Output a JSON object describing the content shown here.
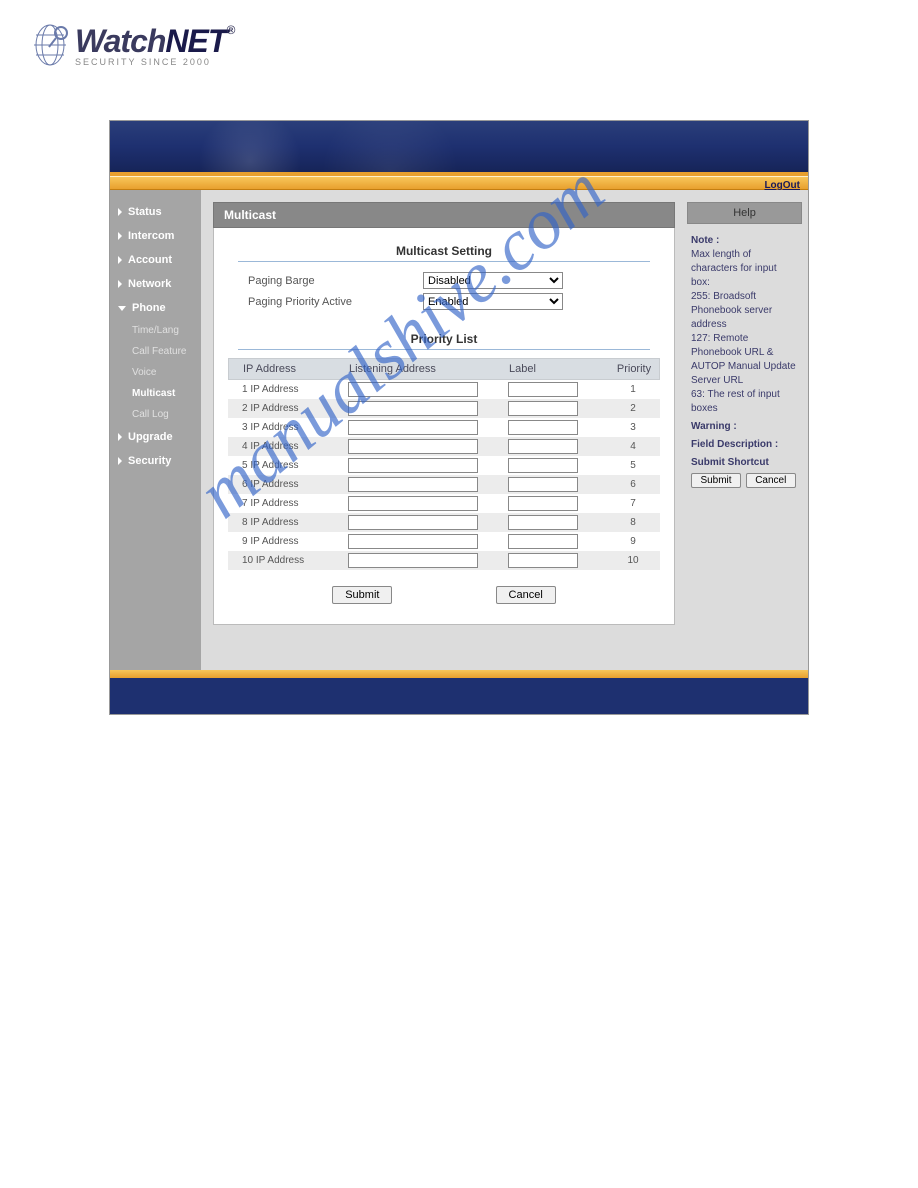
{
  "header": {
    "brand1": "Watch",
    "brand2": "NET",
    "tagline": "SECURITY SINCE 2000"
  },
  "logout": "LogOut",
  "sidebar": {
    "items": [
      {
        "label": "Status"
      },
      {
        "label": "Intercom"
      },
      {
        "label": "Account"
      },
      {
        "label": "Network"
      },
      {
        "label": "Phone",
        "expanded": true,
        "sub": [
          {
            "label": "Time/Lang"
          },
          {
            "label": "Call Feature"
          },
          {
            "label": "Voice"
          },
          {
            "label": "Multicast",
            "active": true
          },
          {
            "label": "Call Log"
          }
        ]
      },
      {
        "label": "Upgrade"
      },
      {
        "label": "Security"
      }
    ]
  },
  "main": {
    "title": "Multicast",
    "multicastSetting": {
      "title": "Multicast Setting",
      "barge": {
        "label": "Paging Barge",
        "value": "Disabled"
      },
      "priorityActive": {
        "label": "Paging Priority Active",
        "value": "Enabled"
      }
    },
    "priorityList": {
      "title": "Priority List",
      "cols": {
        "ip": "IP Address",
        "listen": "Listening Address",
        "label": "Label",
        "priority": "Priority"
      },
      "rows": [
        {
          "ip": "1 IP Address",
          "pri": "1"
        },
        {
          "ip": "2 IP Address",
          "pri": "2"
        },
        {
          "ip": "3 IP Address",
          "pri": "3"
        },
        {
          "ip": "4 IP Address",
          "pri": "4"
        },
        {
          "ip": "5 IP Address",
          "pri": "5"
        },
        {
          "ip": "6 IP Address",
          "pri": "6"
        },
        {
          "ip": "7 IP Address",
          "pri": "7"
        },
        {
          "ip": "8 IP Address",
          "pri": "8"
        },
        {
          "ip": "9 IP Address",
          "pri": "9"
        },
        {
          "ip": "10 IP Address",
          "pri": "10"
        }
      ]
    },
    "buttons": {
      "submit": "Submit",
      "cancel": "Cancel"
    }
  },
  "help": {
    "title": "Help",
    "noteLabel": "Note :",
    "noteText": "Max length of characters for input box:",
    "line1": "255: Broadsoft Phonebook server address",
    "line2": "127: Remote Phonebook URL & AUTOP Manual Update Server URL",
    "line3": "63: The rest of input boxes",
    "warningLabel": "Warning :",
    "fieldDescLabel": "Field Description :",
    "shortcutLabel": "Submit Shortcut",
    "submit": "Submit",
    "cancel": "Cancel"
  },
  "watermark": "manualshive.com"
}
